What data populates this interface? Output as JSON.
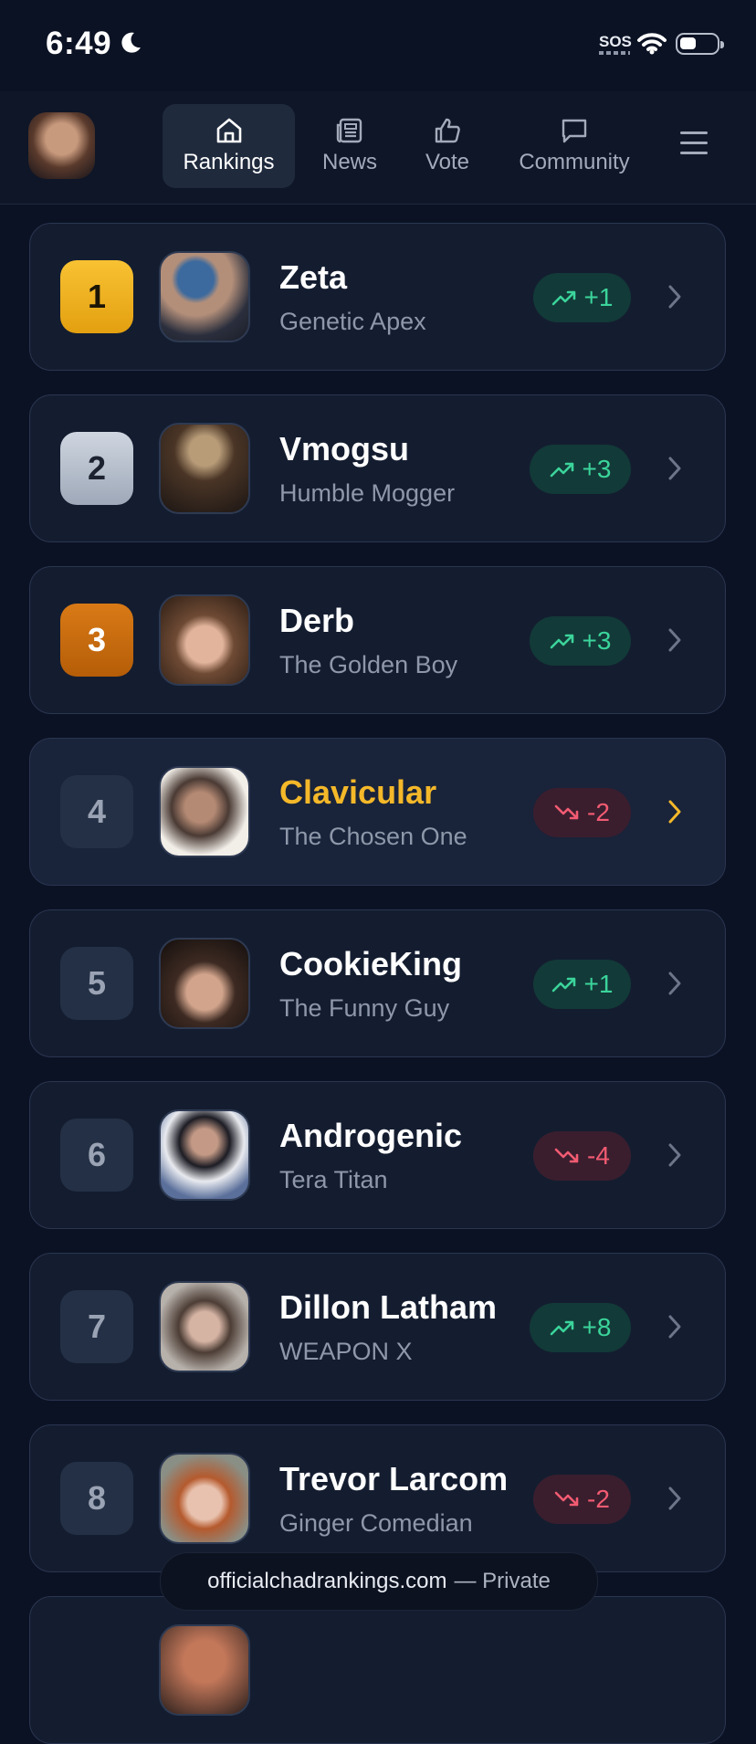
{
  "status_bar": {
    "time": "6:49",
    "sos": "SOS"
  },
  "nav": {
    "tabs": [
      {
        "label": "Rankings",
        "icon": "home-icon",
        "active": true
      },
      {
        "label": "News",
        "icon": "newspaper-icon",
        "active": false
      },
      {
        "label": "Vote",
        "icon": "thumbs-up-icon",
        "active": false
      },
      {
        "label": "Community",
        "icon": "chat-bubble-icon",
        "active": false
      }
    ]
  },
  "rankings": [
    {
      "rank": "1",
      "name": "Zeta",
      "title": "Genetic Apex",
      "change": "+1",
      "direction": "up"
    },
    {
      "rank": "2",
      "name": "Vmogsu",
      "title": "Humble Mogger",
      "change": "+3",
      "direction": "up"
    },
    {
      "rank": "3",
      "name": "Derb",
      "title": "The Golden Boy",
      "change": "+3",
      "direction": "up"
    },
    {
      "rank": "4",
      "name": "Clavicular",
      "title": "The Chosen One",
      "change": "-2",
      "direction": "down"
    },
    {
      "rank": "5",
      "name": "CookieKing",
      "title": "The Funny Guy",
      "change": "+1",
      "direction": "up"
    },
    {
      "rank": "6",
      "name": "Androgenic",
      "title": "Tera Titan",
      "change": "-4",
      "direction": "down"
    },
    {
      "rank": "7",
      "name": "Dillon Latham",
      "title": "WEAPON X",
      "change": "+8",
      "direction": "up"
    },
    {
      "rank": "8",
      "name": "Trevor Larcom",
      "title": "Ginger Comedian",
      "change": "-2",
      "direction": "down"
    }
  ],
  "url_bar": {
    "domain": "officialchadrankings.com",
    "suffix": "— Private"
  },
  "colors": {
    "up": "#3bd49b",
    "down": "#f25b72",
    "highlight": "#f4b829",
    "background": "#0b1224"
  }
}
